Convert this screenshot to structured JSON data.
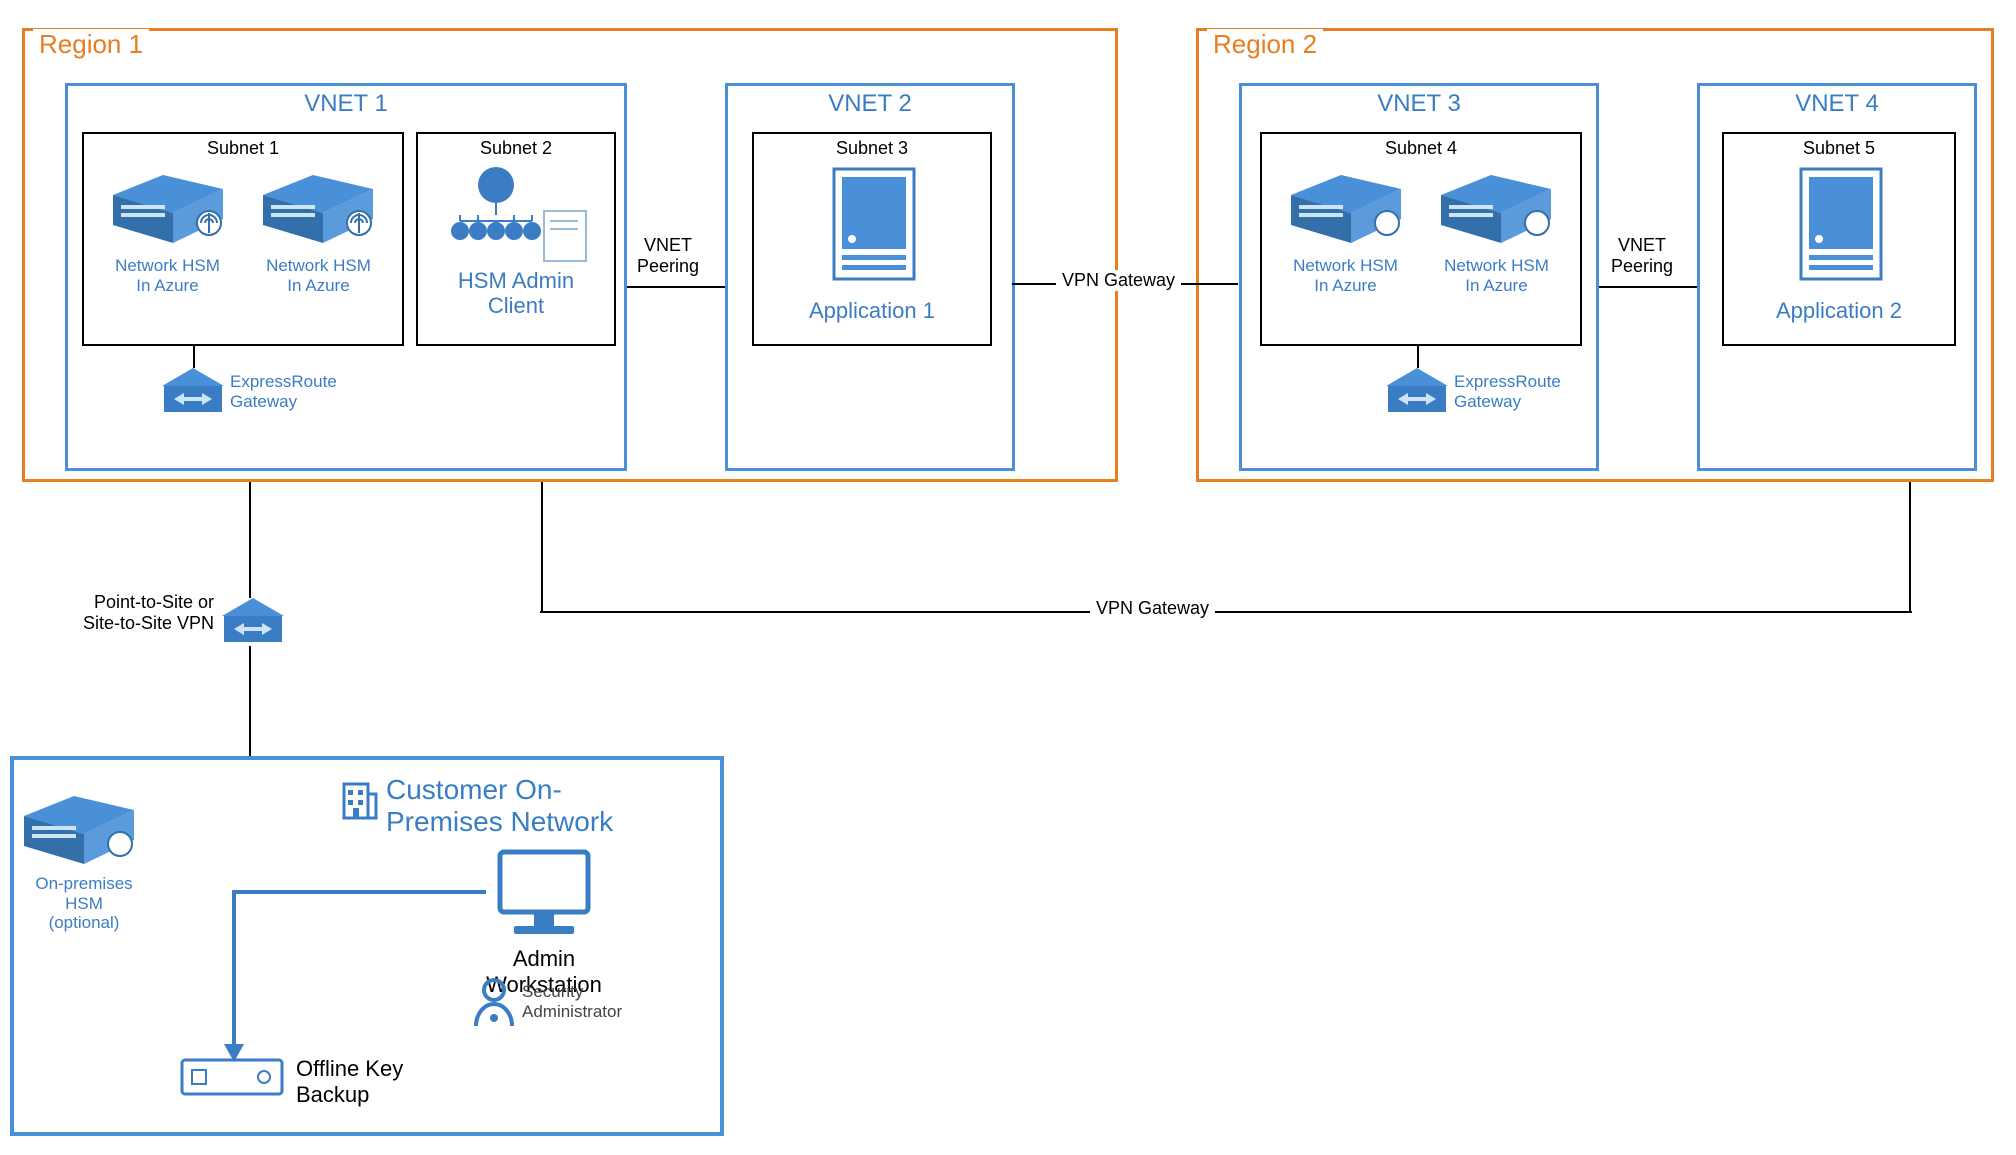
{
  "regions": {
    "r1": {
      "label": "Region 1"
    },
    "r2": {
      "label": "Region 2"
    }
  },
  "vnets": {
    "v1": {
      "label": "VNET 1"
    },
    "v2": {
      "label": "VNET 2"
    },
    "v3": {
      "label": "VNET 3"
    },
    "v4": {
      "label": "VNET 4"
    }
  },
  "subnets": {
    "s1": {
      "label": "Subnet 1",
      "hsm1": "Network HSM\nIn Azure",
      "hsm2": "Network HSM\nIn Azure"
    },
    "s2": {
      "label": "Subnet 2",
      "client": "HSM Admin\nClient"
    },
    "s3": {
      "label": "Subnet 3",
      "app": "Application 1"
    },
    "s4": {
      "label": "Subnet 4",
      "hsm1": "Network HSM\nIn Azure",
      "hsm2": "Network HSM\nIn Azure"
    },
    "s5": {
      "label": "Subnet 5",
      "app": "Application 2"
    }
  },
  "gateways": {
    "er1": "ExpressRoute\nGateway",
    "er2": "ExpressRoute\nGateway",
    "p2s": "Point-to-Site or\nSite-to-Site VPN"
  },
  "links": {
    "peer1": "VNET\nPeering",
    "peer2": "VNET\nPeering",
    "vpn1": "VPN Gateway",
    "vpn2": "VPN Gateway"
  },
  "onprem": {
    "title": "Customer On-\nPremises Network",
    "hsm": "On-premises\nHSM\n(optional)",
    "workstation": "Admin Workstation",
    "secadmin": "Security\nAdministrator",
    "backup": "Offline Key\nBackup"
  }
}
